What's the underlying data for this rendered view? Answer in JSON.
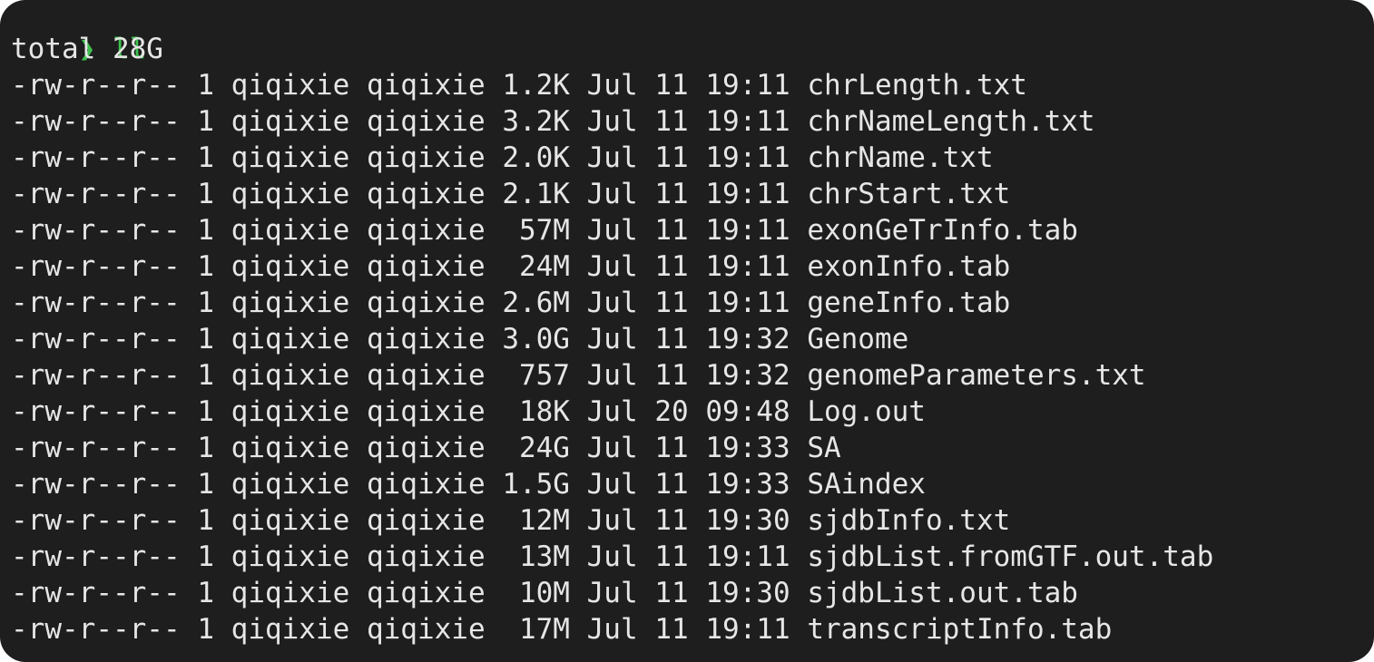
{
  "prompt": {
    "symbol": "❯",
    "command": "ll"
  },
  "total_line": "total 28G",
  "entries": [
    {
      "perms": "-rw-r--r--",
      "links": "1",
      "owner": "qiqixie",
      "group": "qiqixie",
      "size": "1.2K",
      "month": "Jul",
      "day": "11",
      "time": "19:11",
      "name": "chrLength.txt"
    },
    {
      "perms": "-rw-r--r--",
      "links": "1",
      "owner": "qiqixie",
      "group": "qiqixie",
      "size": "3.2K",
      "month": "Jul",
      "day": "11",
      "time": "19:11",
      "name": "chrNameLength.txt"
    },
    {
      "perms": "-rw-r--r--",
      "links": "1",
      "owner": "qiqixie",
      "group": "qiqixie",
      "size": "2.0K",
      "month": "Jul",
      "day": "11",
      "time": "19:11",
      "name": "chrName.txt"
    },
    {
      "perms": "-rw-r--r--",
      "links": "1",
      "owner": "qiqixie",
      "group": "qiqixie",
      "size": "2.1K",
      "month": "Jul",
      "day": "11",
      "time": "19:11",
      "name": "chrStart.txt"
    },
    {
      "perms": "-rw-r--r--",
      "links": "1",
      "owner": "qiqixie",
      "group": "qiqixie",
      "size": " 57M",
      "month": "Jul",
      "day": "11",
      "time": "19:11",
      "name": "exonGeTrInfo.tab"
    },
    {
      "perms": "-rw-r--r--",
      "links": "1",
      "owner": "qiqixie",
      "group": "qiqixie",
      "size": " 24M",
      "month": "Jul",
      "day": "11",
      "time": "19:11",
      "name": "exonInfo.tab"
    },
    {
      "perms": "-rw-r--r--",
      "links": "1",
      "owner": "qiqixie",
      "group": "qiqixie",
      "size": "2.6M",
      "month": "Jul",
      "day": "11",
      "time": "19:11",
      "name": "geneInfo.tab"
    },
    {
      "perms": "-rw-r--r--",
      "links": "1",
      "owner": "qiqixie",
      "group": "qiqixie",
      "size": "3.0G",
      "month": "Jul",
      "day": "11",
      "time": "19:32",
      "name": "Genome"
    },
    {
      "perms": "-rw-r--r--",
      "links": "1",
      "owner": "qiqixie",
      "group": "qiqixie",
      "size": " 757",
      "month": "Jul",
      "day": "11",
      "time": "19:32",
      "name": "genomeParameters.txt"
    },
    {
      "perms": "-rw-r--r--",
      "links": "1",
      "owner": "qiqixie",
      "group": "qiqixie",
      "size": " 18K",
      "month": "Jul",
      "day": "20",
      "time": "09:48",
      "name": "Log.out"
    },
    {
      "perms": "-rw-r--r--",
      "links": "1",
      "owner": "qiqixie",
      "group": "qiqixie",
      "size": " 24G",
      "month": "Jul",
      "day": "11",
      "time": "19:33",
      "name": "SA"
    },
    {
      "perms": "-rw-r--r--",
      "links": "1",
      "owner": "qiqixie",
      "group": "qiqixie",
      "size": "1.5G",
      "month": "Jul",
      "day": "11",
      "time": "19:33",
      "name": "SAindex"
    },
    {
      "perms": "-rw-r--r--",
      "links": "1",
      "owner": "qiqixie",
      "group": "qiqixie",
      "size": " 12M",
      "month": "Jul",
      "day": "11",
      "time": "19:30",
      "name": "sjdbInfo.txt"
    },
    {
      "perms": "-rw-r--r--",
      "links": "1",
      "owner": "qiqixie",
      "group": "qiqixie",
      "size": " 13M",
      "month": "Jul",
      "day": "11",
      "time": "19:11",
      "name": "sjdbList.fromGTF.out.tab"
    },
    {
      "perms": "-rw-r--r--",
      "links": "1",
      "owner": "qiqixie",
      "group": "qiqixie",
      "size": " 10M",
      "month": "Jul",
      "day": "11",
      "time": "19:30",
      "name": "sjdbList.out.tab"
    },
    {
      "perms": "-rw-r--r--",
      "links": "1",
      "owner": "qiqixie",
      "group": "qiqixie",
      "size": " 17M",
      "month": "Jul",
      "day": "11",
      "time": "19:11",
      "name": "transcriptInfo.tab"
    }
  ],
  "colors": {
    "background": "#1e1e1e",
    "text": "#e6e6e6",
    "prompt": "#3fc04f"
  }
}
